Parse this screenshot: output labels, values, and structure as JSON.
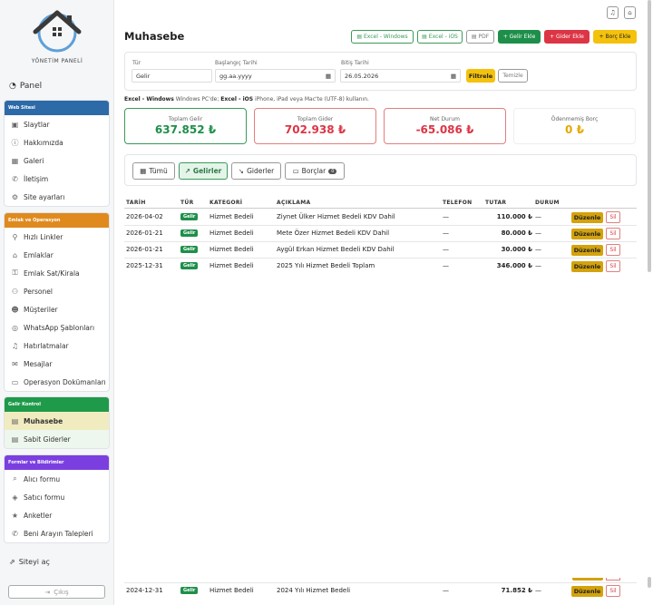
{
  "sidebar": {
    "logo_text": "YÖNETİM PANELİ",
    "panel_label": "Panel",
    "groups": [
      {
        "title": "Web Sitesi",
        "color": "#2d6aa8",
        "items": [
          {
            "label": "Slaytlar",
            "icon": "image-icon"
          },
          {
            "label": "Hakkımızda",
            "icon": "info-icon"
          },
          {
            "label": "Galeri",
            "icon": "grid-icon"
          },
          {
            "label": "İletişim",
            "icon": "phone-icon"
          },
          {
            "label": "Site ayarları",
            "icon": "gear-icon"
          }
        ]
      },
      {
        "title": "Emlak ve Operasyon",
        "color": "#e08a1e",
        "items": [
          {
            "label": "Hızlı Linkler",
            "icon": "link-icon"
          },
          {
            "label": "Emlaklar",
            "icon": "home-icon"
          },
          {
            "label": "Emlak Sat/Kirala",
            "icon": "key-icon"
          },
          {
            "label": "Personel",
            "icon": "users-icon"
          },
          {
            "label": "Müşteriler",
            "icon": "customers-icon"
          },
          {
            "label": "WhatsApp Şablonları",
            "icon": "whatsapp-icon"
          },
          {
            "label": "Hatırlatmalar",
            "icon": "bell-icon"
          },
          {
            "label": "Mesajlar",
            "icon": "mail-icon"
          },
          {
            "label": "Operasyon Dokümanları",
            "icon": "folder-icon"
          }
        ]
      },
      {
        "title": "Gelir Kontrol",
        "color": "#1e9a4a",
        "items": [
          {
            "label": "Muhasebe",
            "icon": "ledger-icon"
          },
          {
            "label": "Sabit Giderler",
            "icon": "list-icon"
          }
        ]
      },
      {
        "title": "Formlar ve Bildirimler",
        "color": "#7b3fe0",
        "items": [
          {
            "label": "Alıcı formu",
            "icon": "search-icon"
          },
          {
            "label": "Satıcı formu",
            "icon": "tag-icon"
          },
          {
            "label": "Anketler",
            "icon": "star-icon"
          },
          {
            "label": "Beni Arayın Talepleri",
            "icon": "phone-icon"
          }
        ]
      }
    ],
    "site_link": "Siteyi aç",
    "logout": "Çıkış"
  },
  "header": {
    "title": "Muhasebe",
    "buttons": {
      "excel_windows": "Excel - Windows",
      "excel_ios": "Excel - iOS",
      "pdf": "PDF",
      "add_income": "+ Gelir Ekle",
      "add_expense": "+ Gider Ekle",
      "add_debt": "+ Borç Ekle"
    }
  },
  "filter": {
    "type_label": "Tür",
    "type_value": "Gelir",
    "start_label": "Başlangıç Tarihi",
    "start_placeholder": "gg.aa.yyyy",
    "end_label": "Bitiş Tarihi",
    "end_value": "26.05.2026",
    "filter_btn": "Filtrele",
    "clear_btn": "Temizle"
  },
  "note": {
    "part1": "Excel - Windows",
    "part2": " Windows PC'de; ",
    "part3": "Excel - iOS",
    "part4": " iPhone, iPad veya Mac'te (UTF-8) kullanın."
  },
  "stats": [
    {
      "label": "Toplam Gelir",
      "value": "637.852 ₺",
      "color": "#1e8f4a",
      "border": "#3a9a5a"
    },
    {
      "label": "Toplam Gider",
      "value": "702.938 ₺",
      "color": "#dc3545",
      "border": "#e08080"
    },
    {
      "label": "Net Durum",
      "value": "-65.086 ₺",
      "color": "#dc3545",
      "border": "#e08080"
    },
    {
      "label": "Ödenmemiş Borç",
      "value": "0 ₺",
      "color": "#e6a800",
      "border": "#ffffff"
    }
  ],
  "tabs": {
    "all": "Tümü",
    "income": "Gelirler",
    "expense": "Giderler",
    "debts": "Borçlar",
    "debts_count": "0"
  },
  "table": {
    "headers": {
      "date": "TARİH",
      "type": "TÜR",
      "category": "KATEGORİ",
      "description": "AÇIKLAMA",
      "phone": "TELEFON",
      "amount": "TUTAR",
      "status": "DURUM"
    },
    "rows": [
      {
        "date": "2026-04-02",
        "type": "Gelir",
        "category": "Hizmet Bedeli",
        "description": "Ziynet Ülker Hizmet Bedeli KDV Dahil",
        "phone": "—",
        "amount": "110.000 ₺",
        "status": "—"
      },
      {
        "date": "2026-01-21",
        "type": "Gelir",
        "category": "Hizmet Bedeli",
        "description": "Mete Özer Hizmet Bedeli KDV Dahil",
        "phone": "—",
        "amount": "80.000 ₺",
        "status": "—"
      },
      {
        "date": "2026-01-21",
        "type": "Gelir",
        "category": "Hizmet Bedeli",
        "description": "Aygül Erkan Hizmet Bedeli KDV Dahil",
        "phone": "—",
        "amount": "30.000 ₺",
        "status": "—"
      },
      {
        "date": "2025-12-31",
        "type": "Gelir",
        "category": "Hizmet Bedeli",
        "description": "2025 Yılı Hizmet Bedeli Toplam",
        "phone": "—",
        "amount": "346.000 ₺",
        "status": "—"
      }
    ],
    "last_row": {
      "date": "2024-12-31",
      "type": "Gelir",
      "category": "Hizmet Bedeli",
      "description": "2024 Yılı Hizmet Bedeli",
      "phone": "—",
      "amount": "71.852 ₺",
      "status": "—"
    },
    "edit_label": "Düzenle",
    "delete_label": "Sil"
  }
}
